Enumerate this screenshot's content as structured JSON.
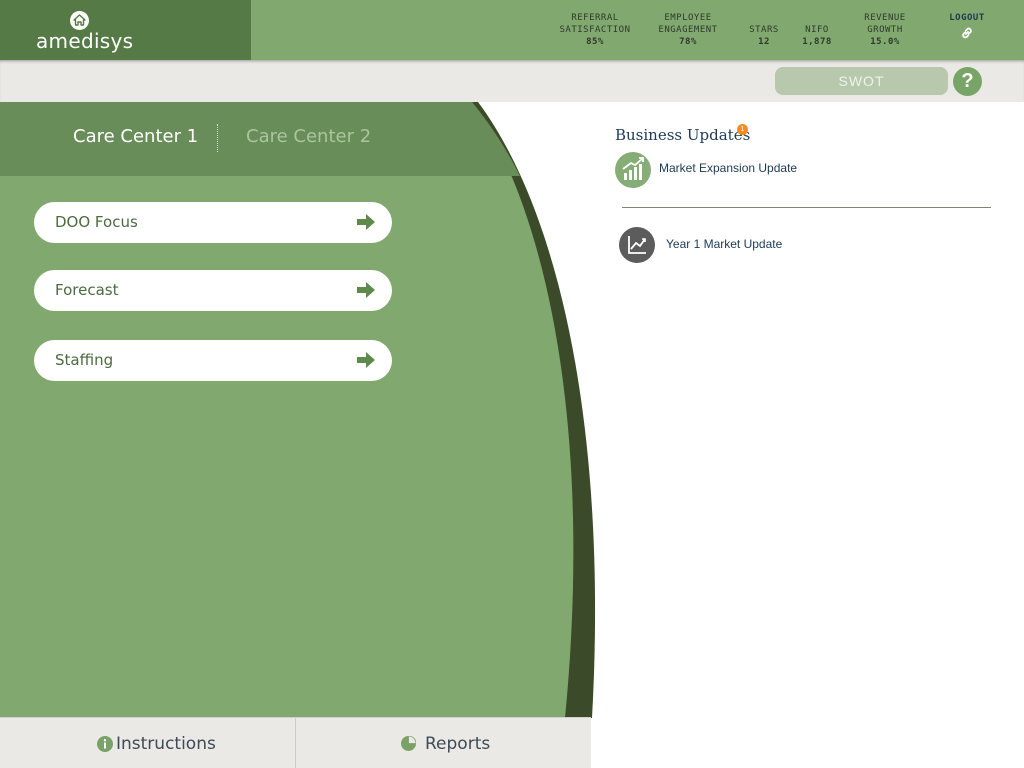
{
  "brand": {
    "name": "amedisys"
  },
  "header": {
    "metrics": [
      {
        "label": "REFERRAL\nSATISFACTION",
        "value": "85%"
      },
      {
        "label": "EMPLOYEE\nENGAGEMENT",
        "value": "78%"
      },
      {
        "label": "STARS",
        "value": "12"
      },
      {
        "label": "NIFO",
        "value": "1,878"
      },
      {
        "label": "REVENUE\nGROWTH",
        "value": "15.0%"
      }
    ],
    "logout_label": "LOGOUT"
  },
  "toolbar": {
    "swot_label": "SWOT",
    "help_label": "?"
  },
  "tabs": [
    {
      "label": "Care Center 1",
      "active": true
    },
    {
      "label": "Care Center 2",
      "active": false
    }
  ],
  "menu": [
    {
      "label": "DOO Focus"
    },
    {
      "label": "Forecast"
    },
    {
      "label": "Staffing"
    }
  ],
  "bottom_tabs": [
    {
      "label": "Instructions",
      "icon": "info-icon"
    },
    {
      "label": "Reports",
      "icon": "pie-chart-icon"
    }
  ],
  "business_updates": {
    "title": "Business Updates",
    "badge": "1",
    "items": [
      {
        "label": "Market Expansion Update",
        "icon": "growth-chart-icon"
      },
      {
        "label": "Year 1 Market Update",
        "icon": "line-chart-icon"
      }
    ]
  },
  "colors": {
    "header_green": "#80a86f",
    "logo_green": "#557a45",
    "panel_green": "#80a86f",
    "tab_bar_green": "#688d58",
    "curve_dark": "#3b4a28",
    "accent_orange": "#f28c1e",
    "navy": "#1b3a57"
  }
}
